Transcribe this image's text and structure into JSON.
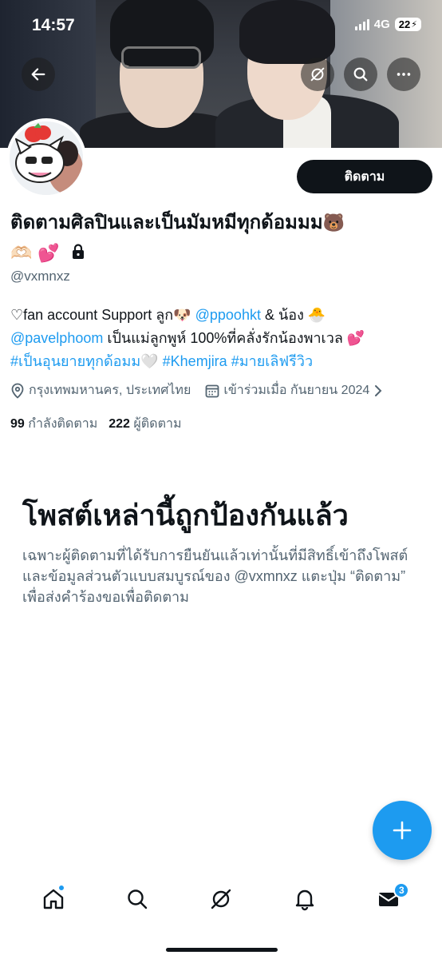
{
  "status_bar": {
    "time": "14:57",
    "network": "4G",
    "battery": "22"
  },
  "profile": {
    "follow_label": "ติดตาม",
    "display_name": "ติดตามศิลปินและเป็นมัมหมีทุกด้อมมม",
    "name_emoji_1": "🐻",
    "name_emoji_2": "🫶🏻",
    "name_emoji_3": "💕",
    "lock_icon": "lock-icon",
    "handle": "@vxmnxz",
    "bio": {
      "part1": "♡fan account Support ลูก",
      "emoji_dog": "🐶",
      "mention1": "@ppoohkt",
      "part2": " & น้อง",
      "emoji_chick": "🐣",
      "mention2": "@pavelphoom",
      "part3": " เป็นแม่ลูกพูห์ 100%ที่คลั่งรักน้องพาเวล ",
      "emoji_heart": "💕",
      "hashtag1": "#เป็นอุนยายทุกด้อมม",
      "emoji_white_heart": "🤍",
      "hashtag2": "#Khemjira",
      "hashtag3": "#มายเลิฟรีวิว"
    },
    "location": "กรุงเทพมหานคร, ประเทศไทย",
    "joined": "เข้าร่วมเมื่อ กันยายน 2024",
    "following_count": "99",
    "following_label": "กำลังติดตาม",
    "followers_count": "222",
    "followers_label": "ผู้ติดตาม"
  },
  "protected": {
    "title": "โพสต์เหล่านี้ถูกป้องกันแล้ว",
    "text": "เฉพาะผู้ติดตามที่ได้รับการยืนยันแล้วเท่านั้นที่มีสิทธิ์เข้าถึงโพสต์และข้อมูลส่วนตัวแบบสมบูรณ์ของ @vxmnxz แตะปุ่ม “ติดตาม” เพื่อส่งคำร้องขอเพื่อติดตาม"
  },
  "tabbar": {
    "messages_badge": "3"
  },
  "colors": {
    "accent": "#1d9bf0",
    "text_primary": "#0f1419",
    "text_secondary": "#536471"
  }
}
